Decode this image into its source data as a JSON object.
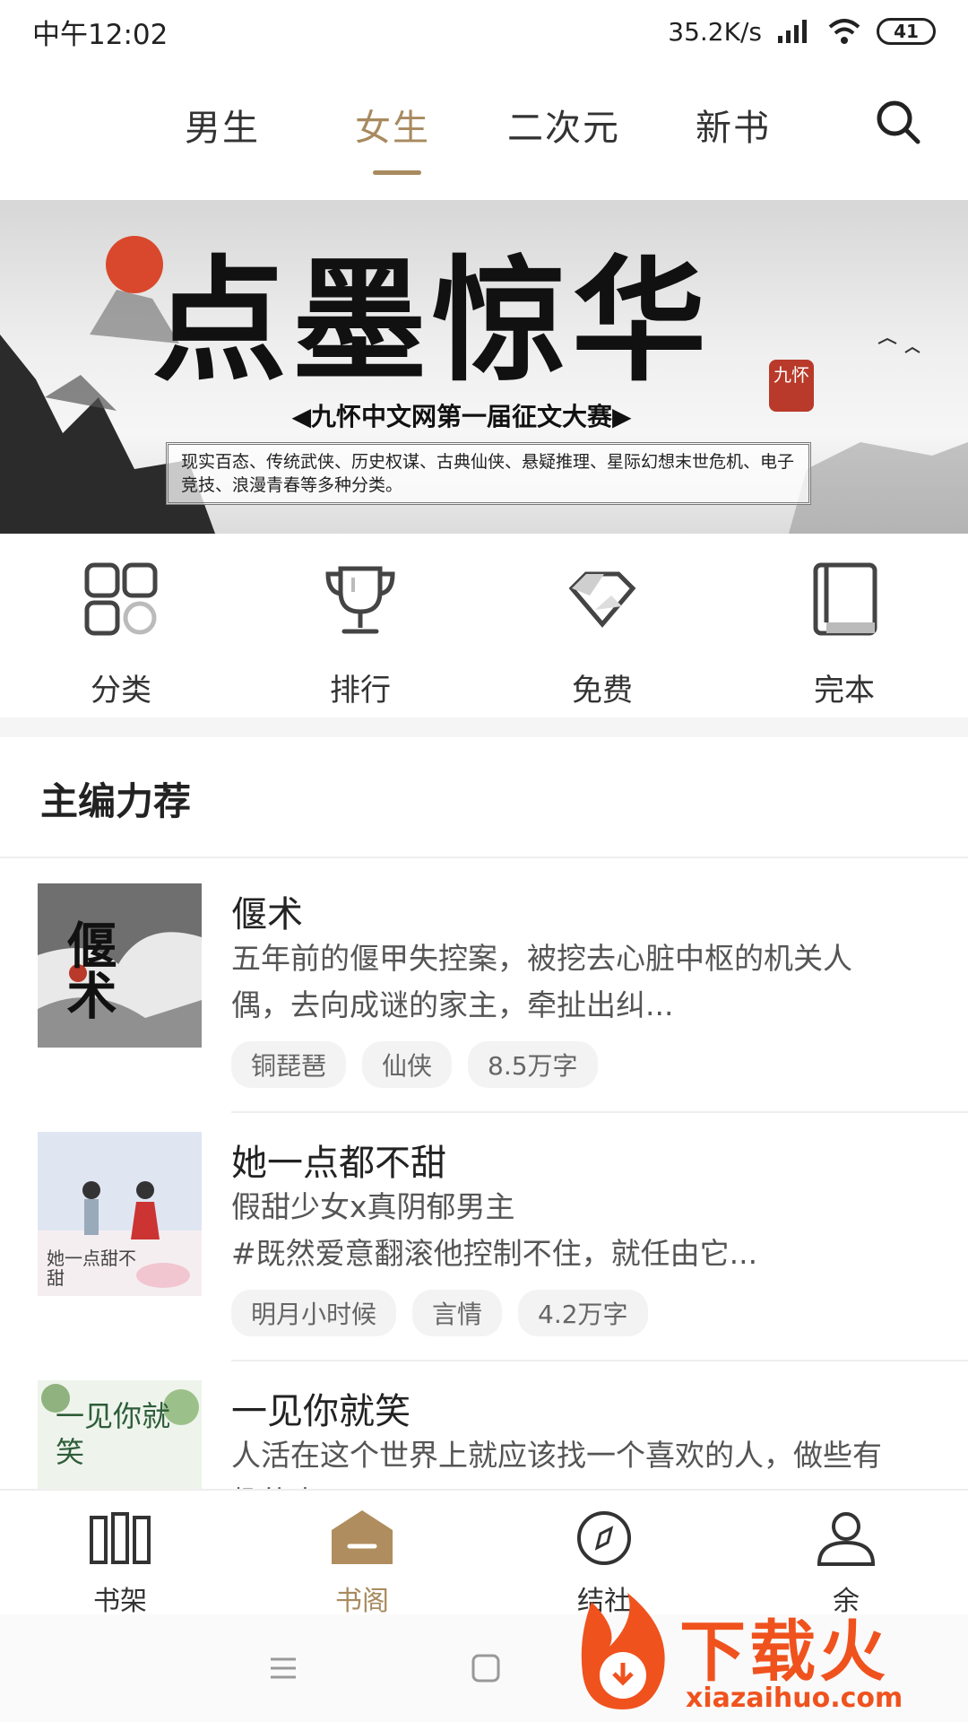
{
  "status_bar": {
    "time": "中午12:02",
    "network_speed": "35.2K/s",
    "battery": "41"
  },
  "tabs": [
    {
      "label": "男生",
      "active": false
    },
    {
      "label": "女生",
      "active": true
    },
    {
      "label": "二次元",
      "active": false
    },
    {
      "label": "新书",
      "active": false
    }
  ],
  "banner": {
    "title": "点墨惊华",
    "seal": "九怀",
    "subtitle": "◀九怀中文网第一届征文大赛▶",
    "description": "现实百态、传统武侠、历史权谋、古典仙侠、悬疑推理、星际幻想末世危机、电子竞技、浪漫青春等多种分类。"
  },
  "quick_nav": [
    {
      "label": "分类",
      "icon": "category-grid-icon"
    },
    {
      "label": "排行",
      "icon": "trophy-icon"
    },
    {
      "label": "免费",
      "icon": "diamond-icon"
    },
    {
      "label": "完本",
      "icon": "book-icon"
    }
  ],
  "section": {
    "title": "主编力荐"
  },
  "books": [
    {
      "title": "偃术",
      "description": "五年前的偃甲失控案，被挖去心脏中枢的机关人偶，去向成谜的家主，牵扯出纠...",
      "tags": [
        "铜琵琶",
        "仙侠",
        "8.5万字"
      ]
    },
    {
      "title": "她一点都不甜",
      "description": "假甜少女x真阴郁男主\n#既然爱意翻滚他控制不住，就任由它...",
      "tags": [
        "明月小时候",
        "言情",
        "4.2万字"
      ]
    },
    {
      "title": "一见你就笑",
      "description": "人活在这个世界上就应该找一个喜欢的人，做些有趣的事",
      "tags": []
    }
  ],
  "covers": [
    {
      "text": "偃术"
    },
    {
      "text": "她一点甜不甜"
    },
    {
      "text": "一见你就笑"
    }
  ],
  "bottom_nav": [
    {
      "label": "书架",
      "icon": "bookshelf-icon",
      "active": false
    },
    {
      "label": "书阁",
      "icon": "library-icon",
      "active": true
    },
    {
      "label": "结社",
      "icon": "compass-icon",
      "active": false
    },
    {
      "label": "余",
      "icon": "user-icon",
      "active": false
    }
  ],
  "watermark": {
    "text": "下载火",
    "url": "xiazaihuo.com"
  },
  "colors": {
    "accent": "#a88a5f",
    "watermark": "#f0521e"
  }
}
